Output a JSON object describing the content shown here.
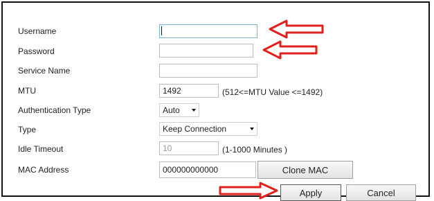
{
  "form": {
    "username": {
      "label": "Username",
      "value": ""
    },
    "password": {
      "label": "Password",
      "value": ""
    },
    "service_name": {
      "label": "Service Name",
      "value": ""
    },
    "mtu": {
      "label": "MTU",
      "value": "1492",
      "hint": "(512<=MTU Value <=1492)"
    },
    "auth_type": {
      "label": "Authentication Type",
      "selected": "Auto"
    },
    "type": {
      "label": "Type",
      "selected": "Keep Connection"
    },
    "idle_timeout": {
      "label": "Idle Timeout",
      "value": "10",
      "hint": "(1-1000 Minutes )"
    },
    "mac_address": {
      "label": "MAC Address",
      "value": "000000000000"
    }
  },
  "buttons": {
    "clone_mac": "Clone MAC",
    "apply": "Apply",
    "cancel": "Cancel"
  },
  "annotations": {
    "arrow_color": "#e0201b",
    "arrow_icon": "red-outline-arrow"
  }
}
